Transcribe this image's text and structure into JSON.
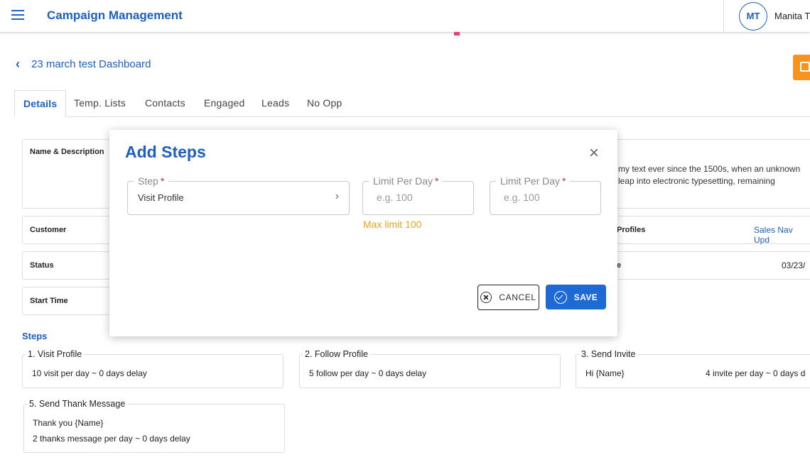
{
  "header": {
    "app_title": "Campaign Management",
    "user_initials": "MT",
    "user_name": "Manita T"
  },
  "page": {
    "back_title": "23 march test Dashboard",
    "tabs": [
      {
        "label": "Details",
        "active": true
      },
      {
        "label": "Temp. Lists",
        "active": false
      },
      {
        "label": "Contacts",
        "active": false
      },
      {
        "label": "Engaged",
        "active": false
      },
      {
        "label": "Leads",
        "active": false
      },
      {
        "label": "No Opp",
        "active": false
      }
    ]
  },
  "details": {
    "name_description_label": "Name & Description",
    "description_line1": "my text ever since the 1500s, when an unknown",
    "description_line2": "leap into electronic typesetting, remaining",
    "customer_label": "Customer",
    "profiles_label": "Profiles",
    "profiles_value": "Sales Nav Upd",
    "status_label": "Status",
    "date_label_fragment": "e",
    "date_value": "03/23/",
    "start_time_label": "Start Time"
  },
  "steps": {
    "heading": "Steps",
    "cards": [
      {
        "title": "1. Visit Profile",
        "lines": [
          "10 visit per day ~ 0 days delay"
        ]
      },
      {
        "title": "2. Follow Profile",
        "lines": [
          "5 follow per day ~ 0 days delay"
        ]
      },
      {
        "title": "3. Send Invite",
        "lines": [
          "Hi {Name}",
          "4 invite per day ~ 0 days d"
        ]
      },
      {
        "title": "5. Send Thank Message",
        "lines": [
          "Thank you {Name}",
          "2 thanks message per day ~ 0 days delay"
        ]
      }
    ]
  },
  "modal": {
    "title": "Add Steps",
    "step_field": {
      "label": "Step",
      "required_mark": "*",
      "value": "Visit Profile"
    },
    "limit_field_1": {
      "label": "Limit Per Day",
      "required_mark": "*",
      "placeholder": "e.g. 100"
    },
    "limit_field_2": {
      "label": "Limit Per Day",
      "required_mark": "*",
      "placeholder": "e.g. 100"
    },
    "max_limit_hint": "Max limit 100",
    "cancel_label": "CANCEL",
    "save_label": "SAVE"
  },
  "colors": {
    "primary": "#1e5fc1",
    "save_button": "#1e6ad4",
    "warning": "#e8a317",
    "required": "#d32f2f",
    "accent_orange": "#f7931e"
  }
}
